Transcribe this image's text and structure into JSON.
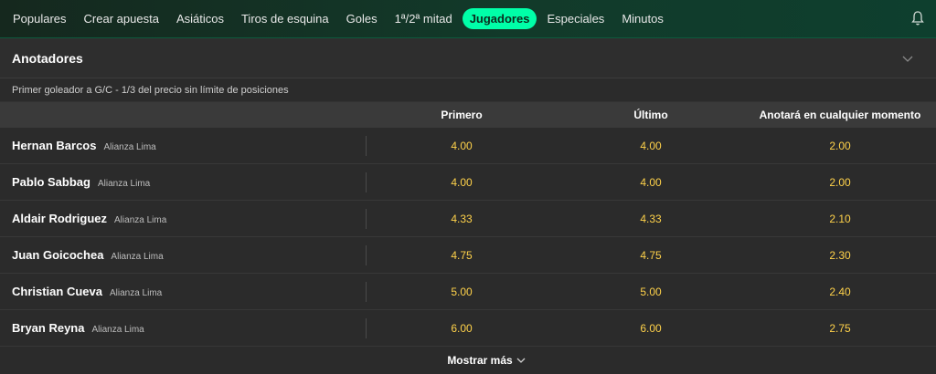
{
  "nav": {
    "tabs": [
      {
        "label": "Populares",
        "active": false
      },
      {
        "label": "Crear apuesta",
        "active": false
      },
      {
        "label": "Asiáticos",
        "active": false
      },
      {
        "label": "Tiros de esquina",
        "active": false
      },
      {
        "label": "Goles",
        "active": false
      },
      {
        "label": "1ª/2ª mitad",
        "active": false
      },
      {
        "label": "Jugadores",
        "active": true
      },
      {
        "label": "Especiales",
        "active": false
      },
      {
        "label": "Minutos",
        "active": false
      }
    ],
    "bell_icon": "bell-icon",
    "active_color": "#00ffa8"
  },
  "section": {
    "title": "Anotadores",
    "chevron_icon": "chevron-down-icon",
    "subtitle": "Primer goleador a G/C - 1/3 del precio sin límite de posiciones"
  },
  "columns": [
    "Primero",
    "Último",
    "Anotará en cualquier momento"
  ],
  "players": [
    {
      "name": "Hernan Barcos",
      "team": "Alianza Lima",
      "odds": [
        "4.00",
        "4.00",
        "2.00"
      ]
    },
    {
      "name": "Pablo Sabbag",
      "team": "Alianza Lima",
      "odds": [
        "4.00",
        "4.00",
        "2.00"
      ]
    },
    {
      "name": "Aldair Rodriguez",
      "team": "Alianza Lima",
      "odds": [
        "4.33",
        "4.33",
        "2.10"
      ]
    },
    {
      "name": "Juan Goicochea",
      "team": "Alianza Lima",
      "odds": [
        "4.75",
        "4.75",
        "2.30"
      ]
    },
    {
      "name": "Christian Cueva",
      "team": "Alianza Lima",
      "odds": [
        "5.00",
        "5.00",
        "2.40"
      ]
    },
    {
      "name": "Bryan Reyna",
      "team": "Alianza Lima",
      "odds": [
        "6.00",
        "6.00",
        "2.75"
      ]
    }
  ],
  "show_more": "Mostrar más",
  "odds_color": "#ffd24a"
}
